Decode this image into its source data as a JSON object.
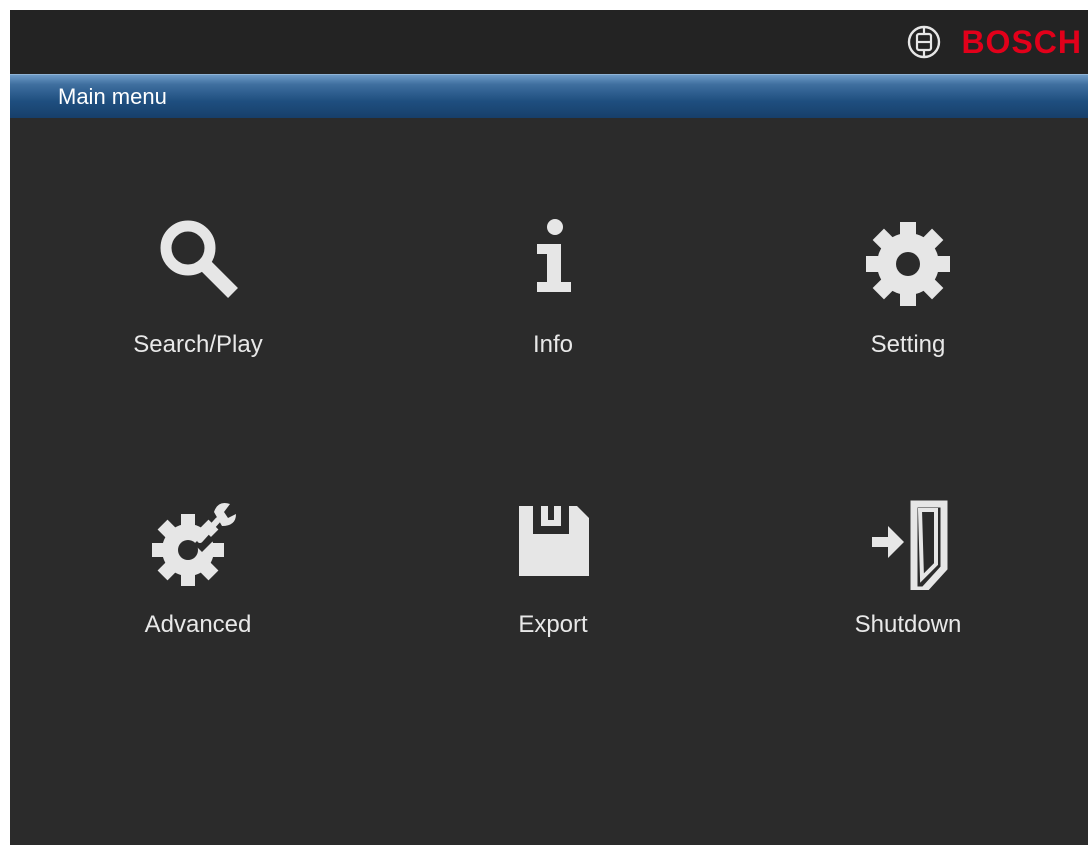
{
  "brand": {
    "name": "BOSCH",
    "color": "#e2001a",
    "emblem_icon": "bosch-armature-icon"
  },
  "title_bar": {
    "title": "Main menu",
    "colors": [
      "#6d9ac6",
      "#1f4f80"
    ]
  },
  "theme": {
    "background": "#2b2b2b",
    "icon_color": "#e6e6e6"
  },
  "menu": {
    "items": [
      {
        "label": "Search/Play",
        "icon": "magnifier-icon"
      },
      {
        "label": "Info",
        "icon": "info-icon"
      },
      {
        "label": "Setting",
        "icon": "gear-icon"
      },
      {
        "label": "Advanced",
        "icon": "gear-wrench-icon"
      },
      {
        "label": "Export",
        "icon": "floppy-disk-icon"
      },
      {
        "label": "Shutdown",
        "icon": "exit-door-icon"
      }
    ]
  }
}
